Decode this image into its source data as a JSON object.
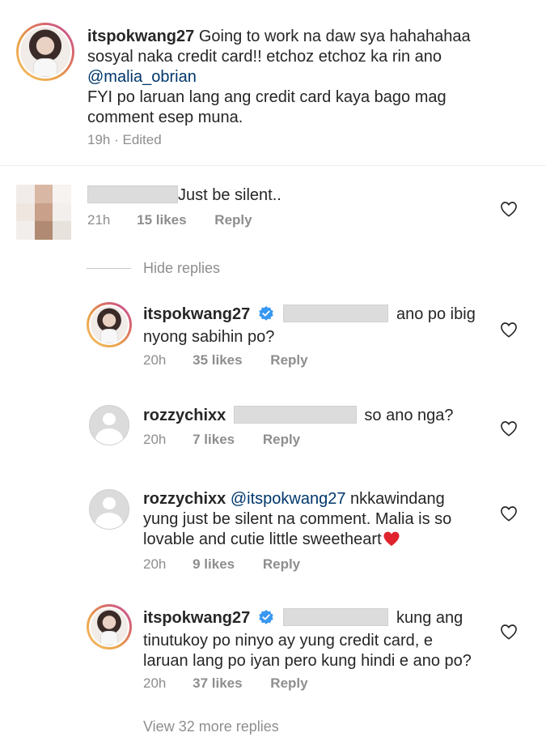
{
  "caption": {
    "username": "itspokwang27",
    "text_line1": " Going to work na daw sya hahahahaa",
    "text_line2": "sosyal naka credit card!! etchoz etchoz ka rin ano",
    "mention": "@malia_obrian",
    "text_line3": "FYI po laruan lang ang credit card kaya bago mag",
    "text_line4": "comment esep muna.",
    "time": "19h",
    "edited": " · Edited"
  },
  "comment1": {
    "text": "Just be silent..",
    "time": "21h",
    "likes": "15 likes",
    "reply": "Reply",
    "hide_replies": "Hide replies"
  },
  "replies": [
    {
      "username": "itspokwang27",
      "text_a": "ano po ibig",
      "text_b": "nyong sabihin po?",
      "time": "20h",
      "likes": "35 likes",
      "reply": "Reply"
    },
    {
      "username": "rozzychixx",
      "text_a": "so ano nga?",
      "time": "20h",
      "likes": "7 likes",
      "reply": "Reply"
    },
    {
      "username": "rozzychixx",
      "mention": "@itspokwang27",
      "text_a": " nkkawindang",
      "text_b": "yung just be silent na comment. Malia is so",
      "text_c": "lovable and cutie little sweetheart",
      "time": "20h",
      "likes": "9 likes",
      "reply": "Reply"
    },
    {
      "username": "itspokwang27",
      "text_a": "kung ang",
      "text_b": "tinutukoy po ninyo ay yung credit card, e",
      "text_c": "laruan lang po iyan pero kung hindi e ano po?",
      "time": "20h",
      "likes": "37 likes",
      "reply": "Reply"
    }
  ],
  "view_more": "View 32 more replies",
  "colors": {
    "text": "#262626",
    "muted": "#8e8e8e",
    "mention": "#00376b",
    "verified": "#3897f0",
    "heart": "#ed4956"
  }
}
